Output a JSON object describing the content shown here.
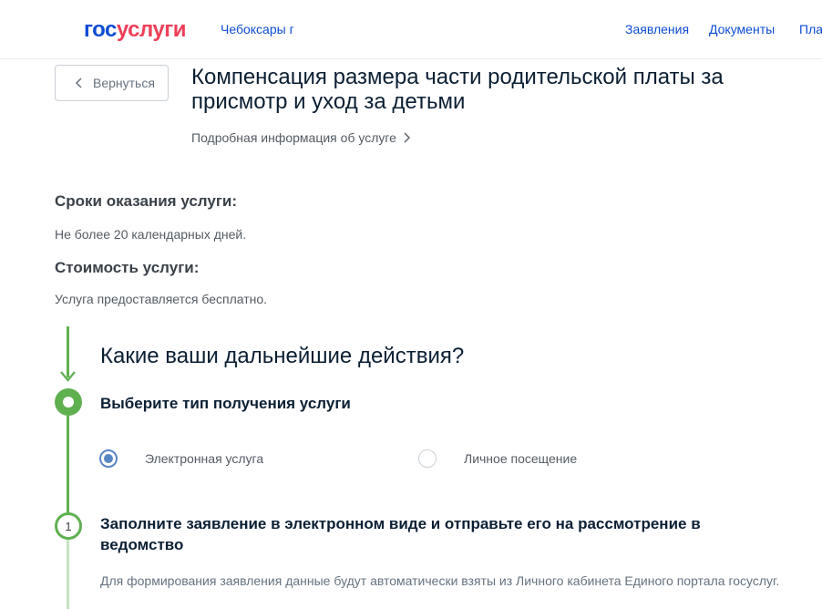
{
  "header": {
    "logo_part1": "гос",
    "logo_part2": "услуги",
    "city": "Чебоксары г",
    "nav": [
      "Заявления",
      "Документы",
      "Пла"
    ]
  },
  "service": {
    "back_label": "Вернуться",
    "title": "Компенсация размера части родительской платы за присмотр и уход за детьми",
    "more_info": "Подробная информация об услуге"
  },
  "terms": {
    "heading": "Сроки оказания услуги:",
    "text": "Не более 20 календарных дней."
  },
  "cost": {
    "heading": "Стоимость услуги:",
    "text": "Услуга предоставляется бесплатно."
  },
  "next_steps": {
    "heading": "Какие ваши дальнейшие действия?",
    "step1": {
      "heading": "Выберите тип получения услуги",
      "options": [
        {
          "label": "Электронная услуга",
          "selected": true
        },
        {
          "label": "Личное посещение",
          "selected": false
        }
      ]
    },
    "step2": {
      "number": "1",
      "heading": "Заполните заявление в электронном виде и отправьте его на рассмотрение в ведомство",
      "text": "Для формирования заявления данные будут автоматически взяты из Личного кабинета Единого портала госуслуг."
    }
  },
  "colors": {
    "brand_blue": "#0d4cd3",
    "brand_red": "#ee3f58",
    "step_green": "#5fb14f",
    "radio_blue": "#5887c5"
  }
}
